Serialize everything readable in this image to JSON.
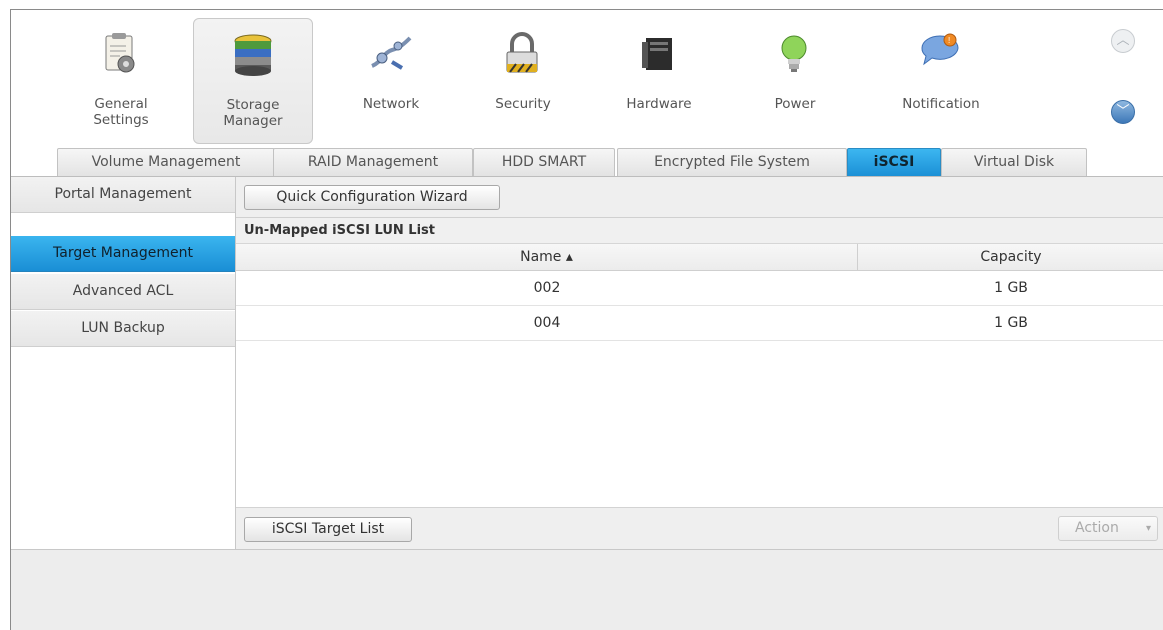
{
  "toolbar": {
    "items": [
      {
        "label": "General\nSettings",
        "icon": "general-settings-icon"
      },
      {
        "label": "Storage\nManager",
        "icon": "storage-manager-icon",
        "active": true
      },
      {
        "label": "Network",
        "icon": "network-icon"
      },
      {
        "label": "Security",
        "icon": "lock-icon"
      },
      {
        "label": "Hardware",
        "icon": "hardware-icon"
      },
      {
        "label": "Power",
        "icon": "lightbulb-icon"
      },
      {
        "label": "Notification",
        "icon": "notification-icon"
      }
    ]
  },
  "tabs": [
    {
      "label": "Volume Management"
    },
    {
      "label": "RAID Management"
    },
    {
      "label": "HDD SMART"
    },
    {
      "label": "Encrypted File System"
    },
    {
      "label": "iSCSI",
      "active": true
    },
    {
      "label": "Virtual Disk"
    }
  ],
  "sidebar": {
    "items": [
      {
        "label": "Portal Management"
      },
      {
        "label": "Target Management",
        "active": true
      },
      {
        "label": "Advanced ACL"
      },
      {
        "label": "LUN Backup"
      }
    ]
  },
  "main": {
    "wizard_button": "Quick Configuration Wizard",
    "section_title": "Un-Mapped iSCSI LUN List",
    "columns": {
      "name": "Name ▴",
      "capacity": "Capacity"
    },
    "rows": [
      {
        "name": "002",
        "capacity": "1 GB"
      },
      {
        "name": "004",
        "capacity": "1 GB"
      }
    ],
    "target_list_button": "iSCSI Target List",
    "action_button": "Action",
    "action_arrow": "▾"
  },
  "colors": {
    "accent": "#1f95da"
  }
}
